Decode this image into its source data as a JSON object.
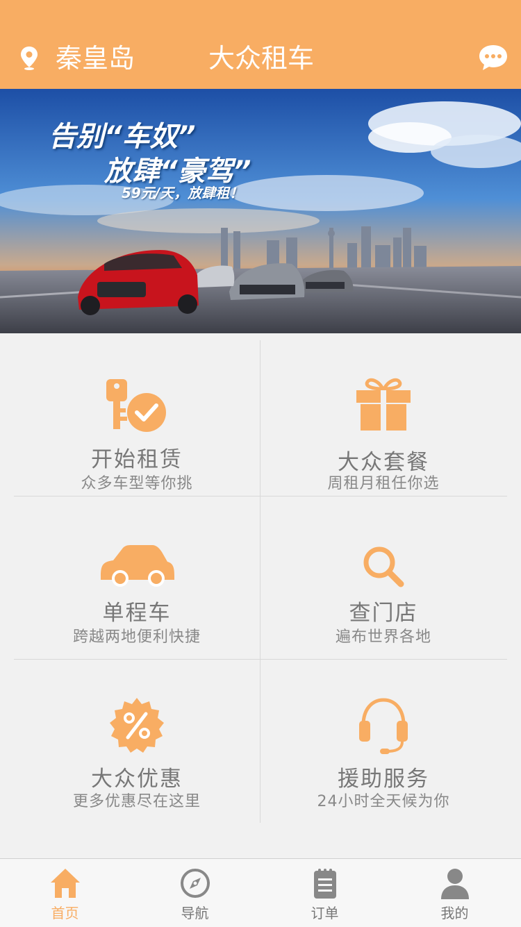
{
  "header": {
    "city": "秦皇岛",
    "title": "大众租车",
    "location_icon": "location-pin-icon",
    "message_icon": "chat-bubble-icon"
  },
  "banner": {
    "line1": "告别“车奴”",
    "line2": "放肆“豪驾”",
    "line3": "59元/天，放肆租！"
  },
  "colors": {
    "accent": "#f8ad63",
    "background": "#f1f1f1",
    "icon_gray": "#888888"
  },
  "menu": [
    {
      "title": "开始租赁",
      "subtitle": "众多车型等你挑",
      "icon": "key-check-icon"
    },
    {
      "title": "大众套餐",
      "subtitle": "周租月租任你选",
      "icon": "gift-icon"
    },
    {
      "title": "单程车",
      "subtitle": "跨越两地便利快捷",
      "icon": "car-icon"
    },
    {
      "title": "查门店",
      "subtitle": "遍布世界各地",
      "icon": "search-icon"
    },
    {
      "title": "大众优惠",
      "subtitle": "更多优惠尽在这里",
      "icon": "discount-badge-icon"
    },
    {
      "title": "援助服务",
      "subtitle": "24小时全天候为你",
      "icon": "headset-icon"
    }
  ],
  "tabs": [
    {
      "label": "首页",
      "icon": "home-icon",
      "active": true
    },
    {
      "label": "导航",
      "icon": "compass-icon",
      "active": false
    },
    {
      "label": "订单",
      "icon": "clipboard-icon",
      "active": false
    },
    {
      "label": "我的",
      "icon": "user-icon",
      "active": false
    }
  ]
}
